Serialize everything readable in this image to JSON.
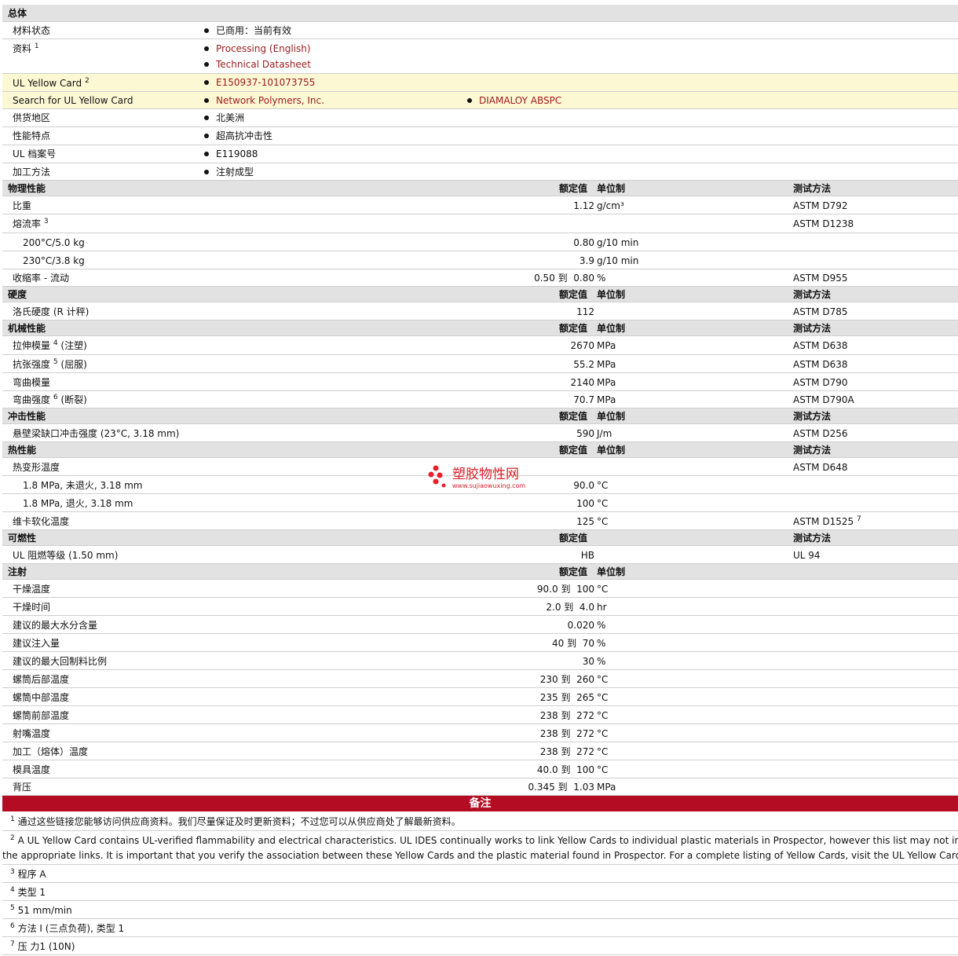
{
  "general": {
    "title": "总体",
    "material_status": {
      "label": "材料状态",
      "value": "已商用：当前有效"
    },
    "info": {
      "label": "资料",
      "sup": "1",
      "links": [
        "Processing (English)",
        "Technical Datasheet"
      ]
    },
    "ul_card": {
      "label": "UL Yellow Card",
      "sup": "2",
      "value": "E150937-101073755"
    },
    "ul_search": {
      "label": "Search for UL Yellow Card",
      "value1": "Network Polymers, Inc.",
      "value2": "DIAMALOY ABSPC"
    },
    "region": {
      "label": "供货地区",
      "value": "北美洲"
    },
    "features": {
      "label": "性能特点",
      "value": "超高抗冲击性"
    },
    "ul_file": {
      "label": "UL 档案号",
      "value": "E119088"
    },
    "processing": {
      "label": "加工方法",
      "value": "注射成型"
    }
  },
  "columns": {
    "value": "额定值",
    "unit": "单位制",
    "method": "测试方法"
  },
  "sections": {
    "physical": {
      "title": "物理性能",
      "r0": {
        "label": "比重",
        "value": "1.12",
        "unit": "g/cm³",
        "method": "ASTM D792"
      },
      "r1": {
        "label": "熔流率",
        "sup": "3",
        "method": "ASTM D1238"
      },
      "r2": {
        "label": "200°C/5.0 kg",
        "value": "0.80",
        "unit": "g/10 min"
      },
      "r3": {
        "label": "230°C/3.8 kg",
        "value": "3.9",
        "unit": "g/10 min"
      },
      "r4": {
        "label": "收缩率 - 流动",
        "value": "0.50 到  0.80",
        "unit": "%",
        "method": "ASTM D955"
      }
    },
    "hardness": {
      "title": "硬度",
      "r0": {
        "label": "洛氏硬度 (R 计秤)",
        "value": "112",
        "method": "ASTM D785"
      }
    },
    "mechanical": {
      "title": "机械性能",
      "r0": {
        "label": "拉伸模量",
        "sup": "4",
        "suffix": " (注塑)",
        "value": "2670",
        "unit": "MPa",
        "method": "ASTM D638"
      },
      "r1": {
        "label": "抗张强度",
        "sup": "5",
        "suffix": " (屈服)",
        "value": "55.2",
        "unit": "MPa",
        "method": "ASTM D638"
      },
      "r2": {
        "label": "弯曲模量",
        "value": "2140",
        "unit": "MPa",
        "method": "ASTM D790"
      },
      "r3": {
        "label": "弯曲强度",
        "sup": "6",
        "suffix": " (断裂)",
        "value": "70.7",
        "unit": "MPa",
        "method": "ASTM D790A"
      }
    },
    "impact": {
      "title": "冲击性能",
      "r0": {
        "label": "悬壁梁缺口冲击强度 (23°C, 3.18 mm)",
        "value": "590",
        "unit": "J/m",
        "method": "ASTM D256"
      }
    },
    "thermal": {
      "title": "热性能",
      "r0": {
        "label": "热变形温度",
        "method": "ASTM D648"
      },
      "r1": {
        "label": "1.8 MPa, 未退火, 3.18 mm",
        "value": "90.0",
        "unit": "°C"
      },
      "r2": {
        "label": "1.8 MPa, 退火, 3.18 mm",
        "value": "100",
        "unit": "°C"
      },
      "r3": {
        "label": "维卡软化温度",
        "value": "125",
        "unit": "°C",
        "method": "ASTM D1525",
        "msup": "7"
      }
    },
    "flammability": {
      "title": "可燃性",
      "r0": {
        "label": "UL 阻燃等级 (1.50 mm)",
        "value": "HB",
        "method": "UL 94"
      }
    },
    "injection": {
      "title": "注射",
      "r0": {
        "label": "干燥温度",
        "value": "90.0 到  100",
        "unit": "°C"
      },
      "r1": {
        "label": "干燥时间",
        "value": "2.0 到  4.0",
        "unit": "hr"
      },
      "r2": {
        "label": "建议的最大水分含量",
        "value": "0.020",
        "unit": "%"
      },
      "r3": {
        "label": "建议注入量",
        "value": "40 到  70",
        "unit": "%"
      },
      "r4": {
        "label": "建议的最大回制料比例",
        "value": "30",
        "unit": "%"
      },
      "r5": {
        "label": "螺筒后部温度",
        "value": "230 到  260",
        "unit": "°C"
      },
      "r6": {
        "label": "螺筒中部温度",
        "value": "235 到  265",
        "unit": "°C"
      },
      "r7": {
        "label": "螺筒前部温度",
        "value": "238 到  272",
        "unit": "°C"
      },
      "r8": {
        "label": "射嘴温度",
        "value": "238 到  272",
        "unit": "°C"
      },
      "r9": {
        "label": "加工（熔体）温度",
        "value": "238 到  272",
        "unit": "°C"
      },
      "r10": {
        "label": "模具温度",
        "value": "40.0 到  100",
        "unit": "°C"
      },
      "r11": {
        "label": "背压",
        "value": "0.345 到  1.03",
        "unit": "MPa"
      }
    }
  },
  "notes": {
    "title": "备注",
    "n1": {
      "num": "1",
      "text": "通过这些链接您能够访问供应商资料。我们尽量保证及时更新资料；不过您可以从供应商处了解最新资料。"
    },
    "n2": {
      "num": "2",
      "line1": "A UL Yellow Card contains UL-verified flammability and electrical characteristics. UL IDES continually works to link Yellow Cards to individual plastic materials in Prospector, however this list may not include all of",
      "line2": "the appropriate links. It is important that you verify the association between these Yellow Cards and the plastic material found in Prospector. For a complete listing of Yellow Cards, visit the UL Yellow Card Search."
    },
    "n3": {
      "num": "3",
      "text": "程序  A"
    },
    "n4": {
      "num": "4",
      "text": "类型  1"
    },
    "n5": {
      "num": "5",
      "text": "51 mm/min"
    },
    "n6": {
      "num": "6",
      "text": "方法  I (三点负荷), 类型  1"
    },
    "n7": {
      "num": "7",
      "text": "压  力1 (10N)"
    }
  },
  "watermark": {
    "name": "塑胶物性网",
    "url": "www.sujiaowuxing.com"
  },
  "colors": {
    "section_bg": "#e2e2e2",
    "yellow_row": "#fcf8d4",
    "link": "#9b1a1a",
    "notes_bar": "#b40c22"
  }
}
